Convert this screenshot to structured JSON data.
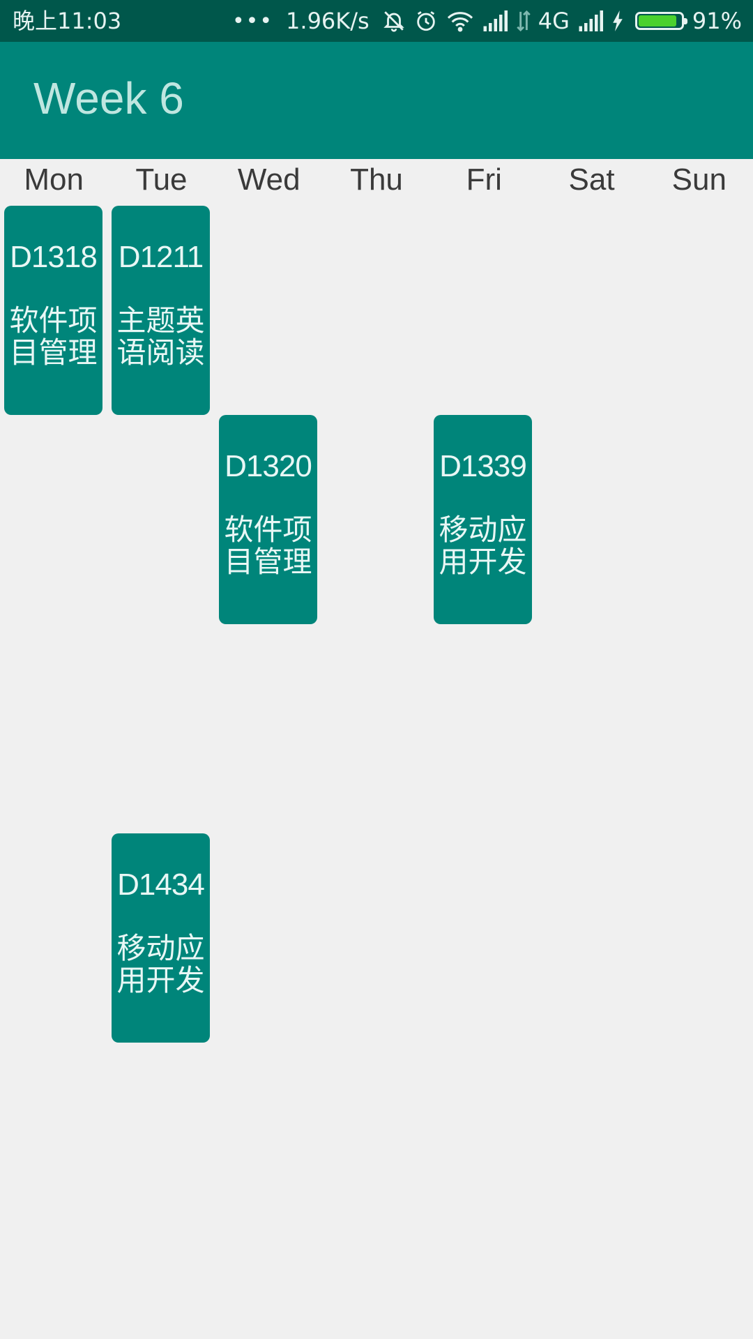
{
  "status_bar": {
    "time": "晚上11:03",
    "dots": "•••",
    "speed": "1.96K/s",
    "network": "4G",
    "battery_percent": "91%",
    "battery_level": 0.91,
    "icons": [
      "notifications-off-icon",
      "alarm-icon",
      "wifi-icon",
      "signal-icon",
      "data-arrows-icon",
      "signal-icon",
      "charging-icon",
      "battery-icon"
    ]
  },
  "app_bar": {
    "title": "Week 6"
  },
  "days": [
    "Mon",
    "Tue",
    "Wed",
    "Thu",
    "Fri",
    "Sat",
    "Sun"
  ],
  "courses": [
    {
      "day": "Mon",
      "code": "D1318",
      "name": "软件项目管理"
    },
    {
      "day": "Tue",
      "code": "D1211",
      "name": "主题英语阅读"
    },
    {
      "day": "Wed",
      "code": "D1320",
      "name": "软件项目管理"
    },
    {
      "day": "Fri",
      "code": "D1339",
      "name": "移动应用开发"
    },
    {
      "day": "Tue",
      "code": "D1434",
      "name": "移动应用开发"
    }
  ],
  "colors": {
    "status_bar": "#00574b",
    "app_bar": "#00857a",
    "course_card": "#00857a",
    "background": "#f0f0f0"
  }
}
